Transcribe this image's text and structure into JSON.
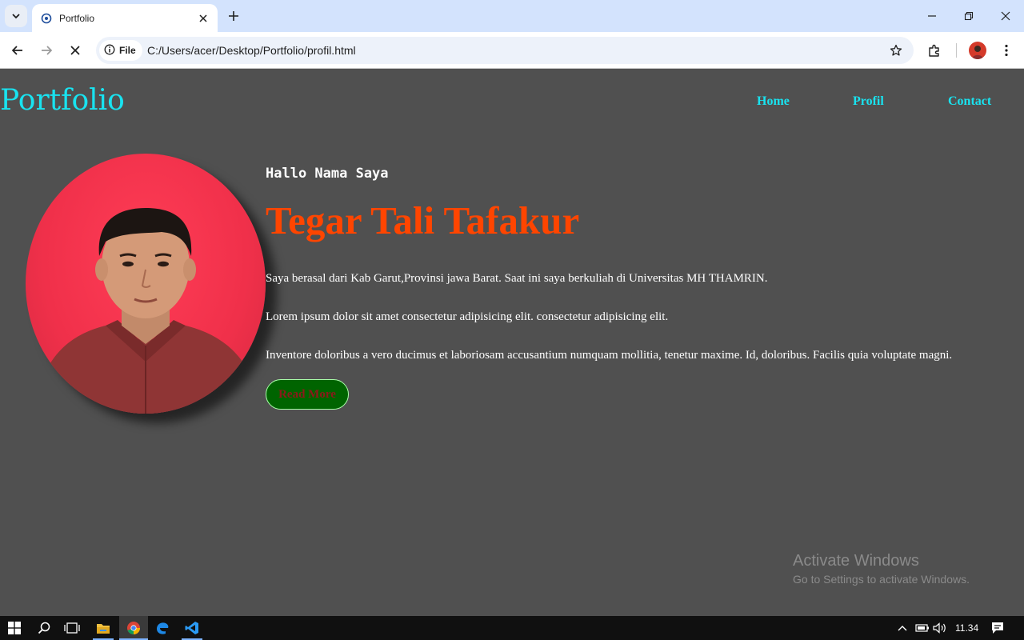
{
  "browser": {
    "tab_title": "Portfolio",
    "chip_label": "File",
    "url": "C:/Users/acer/Desktop/Portfolio/profil.html"
  },
  "site": {
    "logo": "Portfolio",
    "nav": [
      "Home",
      "Profil",
      "Contact"
    ],
    "greeting": "Hallo Nama Saya",
    "name": "Tegar Tali Tafakur",
    "paragraphs": [
      "Saya berasal dari Kab Garut,Provinsi jawa Barat. Saat ini saya berkuliah di Universitas MH THAMRIN.",
      "Lorem ipsum dolor sit amet consectetur adipisicing elit. consectetur adipisicing elit.",
      "Inventore doloribus a vero ducimus et laboriosam accusantium numquam mollitia, tenetur maxime. Id, doloribus. Facilis quia voluptate magni."
    ],
    "button_label": "Read More"
  },
  "watermark": {
    "title": "Activate Windows",
    "subtitle": "Go to Settings to activate Windows."
  },
  "taskbar": {
    "time": "11.34"
  },
  "colors": {
    "page_bg": "#505050",
    "accent_cyan": "#19e3f0",
    "name_orange": "#ff4500",
    "button_green": "#006400"
  },
  "icons": [
    "tab-search-icon",
    "globe-icon",
    "close-icon",
    "plus-icon",
    "minimize-icon",
    "restore-icon",
    "back-arrow-icon",
    "forward-arrow-icon",
    "stop-loading-icon",
    "info-icon",
    "star-icon",
    "extensions-icon",
    "menu-dots-icon",
    "windows-start-icon",
    "search-icon",
    "task-view-icon",
    "file-explorer-icon",
    "chrome-icon",
    "edge-icon",
    "vscode-icon",
    "chevron-up-icon",
    "battery-icon",
    "volume-icon",
    "notification-icon"
  ]
}
